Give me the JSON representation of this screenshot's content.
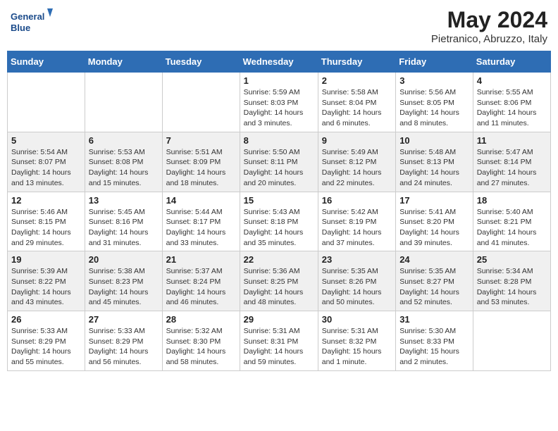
{
  "header": {
    "logo_line1": "General",
    "logo_line2": "Blue",
    "title": "May 2024",
    "location": "Pietranico, Abruzzo, Italy"
  },
  "weekdays": [
    "Sunday",
    "Monday",
    "Tuesday",
    "Wednesday",
    "Thursday",
    "Friday",
    "Saturday"
  ],
  "weeks": [
    [
      {
        "day": "",
        "info": ""
      },
      {
        "day": "",
        "info": ""
      },
      {
        "day": "",
        "info": ""
      },
      {
        "day": "1",
        "info": "Sunrise: 5:59 AM\nSunset: 8:03 PM\nDaylight: 14 hours\nand 3 minutes."
      },
      {
        "day": "2",
        "info": "Sunrise: 5:58 AM\nSunset: 8:04 PM\nDaylight: 14 hours\nand 6 minutes."
      },
      {
        "day": "3",
        "info": "Sunrise: 5:56 AM\nSunset: 8:05 PM\nDaylight: 14 hours\nand 8 minutes."
      },
      {
        "day": "4",
        "info": "Sunrise: 5:55 AM\nSunset: 8:06 PM\nDaylight: 14 hours\nand 11 minutes."
      }
    ],
    [
      {
        "day": "5",
        "info": "Sunrise: 5:54 AM\nSunset: 8:07 PM\nDaylight: 14 hours\nand 13 minutes."
      },
      {
        "day": "6",
        "info": "Sunrise: 5:53 AM\nSunset: 8:08 PM\nDaylight: 14 hours\nand 15 minutes."
      },
      {
        "day": "7",
        "info": "Sunrise: 5:51 AM\nSunset: 8:09 PM\nDaylight: 14 hours\nand 18 minutes."
      },
      {
        "day": "8",
        "info": "Sunrise: 5:50 AM\nSunset: 8:11 PM\nDaylight: 14 hours\nand 20 minutes."
      },
      {
        "day": "9",
        "info": "Sunrise: 5:49 AM\nSunset: 8:12 PM\nDaylight: 14 hours\nand 22 minutes."
      },
      {
        "day": "10",
        "info": "Sunrise: 5:48 AM\nSunset: 8:13 PM\nDaylight: 14 hours\nand 24 minutes."
      },
      {
        "day": "11",
        "info": "Sunrise: 5:47 AM\nSunset: 8:14 PM\nDaylight: 14 hours\nand 27 minutes."
      }
    ],
    [
      {
        "day": "12",
        "info": "Sunrise: 5:46 AM\nSunset: 8:15 PM\nDaylight: 14 hours\nand 29 minutes."
      },
      {
        "day": "13",
        "info": "Sunrise: 5:45 AM\nSunset: 8:16 PM\nDaylight: 14 hours\nand 31 minutes."
      },
      {
        "day": "14",
        "info": "Sunrise: 5:44 AM\nSunset: 8:17 PM\nDaylight: 14 hours\nand 33 minutes."
      },
      {
        "day": "15",
        "info": "Sunrise: 5:43 AM\nSunset: 8:18 PM\nDaylight: 14 hours\nand 35 minutes."
      },
      {
        "day": "16",
        "info": "Sunrise: 5:42 AM\nSunset: 8:19 PM\nDaylight: 14 hours\nand 37 minutes."
      },
      {
        "day": "17",
        "info": "Sunrise: 5:41 AM\nSunset: 8:20 PM\nDaylight: 14 hours\nand 39 minutes."
      },
      {
        "day": "18",
        "info": "Sunrise: 5:40 AM\nSunset: 8:21 PM\nDaylight: 14 hours\nand 41 minutes."
      }
    ],
    [
      {
        "day": "19",
        "info": "Sunrise: 5:39 AM\nSunset: 8:22 PM\nDaylight: 14 hours\nand 43 minutes."
      },
      {
        "day": "20",
        "info": "Sunrise: 5:38 AM\nSunset: 8:23 PM\nDaylight: 14 hours\nand 45 minutes."
      },
      {
        "day": "21",
        "info": "Sunrise: 5:37 AM\nSunset: 8:24 PM\nDaylight: 14 hours\nand 46 minutes."
      },
      {
        "day": "22",
        "info": "Sunrise: 5:36 AM\nSunset: 8:25 PM\nDaylight: 14 hours\nand 48 minutes."
      },
      {
        "day": "23",
        "info": "Sunrise: 5:35 AM\nSunset: 8:26 PM\nDaylight: 14 hours\nand 50 minutes."
      },
      {
        "day": "24",
        "info": "Sunrise: 5:35 AM\nSunset: 8:27 PM\nDaylight: 14 hours\nand 52 minutes."
      },
      {
        "day": "25",
        "info": "Sunrise: 5:34 AM\nSunset: 8:28 PM\nDaylight: 14 hours\nand 53 minutes."
      }
    ],
    [
      {
        "day": "26",
        "info": "Sunrise: 5:33 AM\nSunset: 8:29 PM\nDaylight: 14 hours\nand 55 minutes."
      },
      {
        "day": "27",
        "info": "Sunrise: 5:33 AM\nSunset: 8:29 PM\nDaylight: 14 hours\nand 56 minutes."
      },
      {
        "day": "28",
        "info": "Sunrise: 5:32 AM\nSunset: 8:30 PM\nDaylight: 14 hours\nand 58 minutes."
      },
      {
        "day": "29",
        "info": "Sunrise: 5:31 AM\nSunset: 8:31 PM\nDaylight: 14 hours\nand 59 minutes."
      },
      {
        "day": "30",
        "info": "Sunrise: 5:31 AM\nSunset: 8:32 PM\nDaylight: 15 hours\nand 1 minute."
      },
      {
        "day": "31",
        "info": "Sunrise: 5:30 AM\nSunset: 8:33 PM\nDaylight: 15 hours\nand 2 minutes."
      },
      {
        "day": "",
        "info": ""
      }
    ]
  ]
}
